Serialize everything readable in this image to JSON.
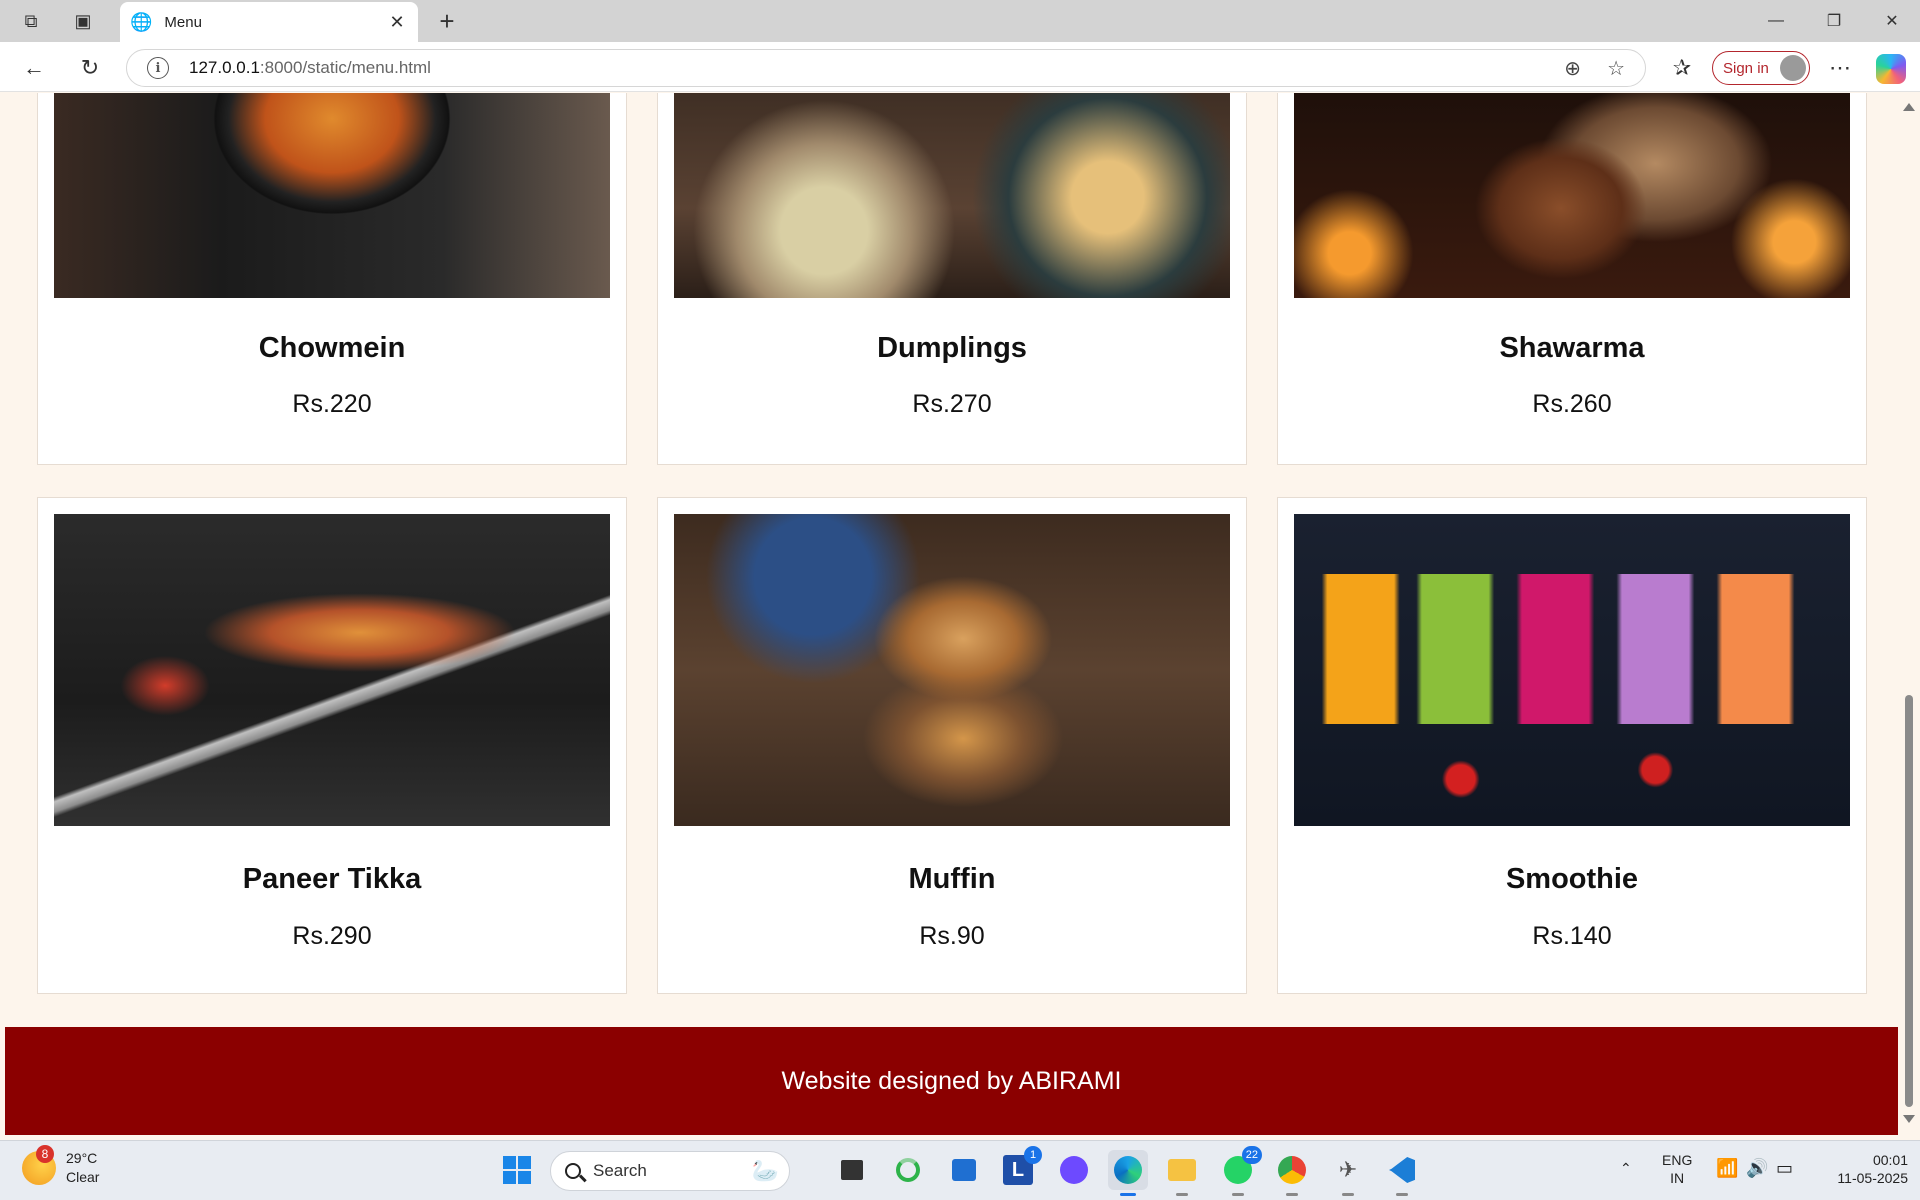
{
  "browser": {
    "tab_title": "Menu",
    "url_host": "127.0.0.1",
    "url_path": ":8000/static/menu.html",
    "sign_in_label": "Sign in"
  },
  "menu": {
    "items": [
      {
        "name": "Chowmein",
        "price": "Rs.220"
      },
      {
        "name": "Dumplings",
        "price": "Rs.270"
      },
      {
        "name": "Shawarma",
        "price": "Rs.260"
      },
      {
        "name": "Paneer Tikka",
        "price": "Rs.290"
      },
      {
        "name": "Muffin",
        "price": "Rs.90"
      },
      {
        "name": "Smoothie",
        "price": "Rs.140"
      }
    ]
  },
  "footer": {
    "text": "Website designed by ABIRAMI",
    "bg_color": "#8b0000"
  },
  "taskbar": {
    "weather_alert_count": "8",
    "weather_temp": "29°C",
    "weather_desc": "Clear",
    "search_label": "Search",
    "teams_badge": "1",
    "whatsapp_badge": "22",
    "language": "ENG",
    "region": "IN",
    "time": "00:01",
    "date": "11-05-2025"
  }
}
